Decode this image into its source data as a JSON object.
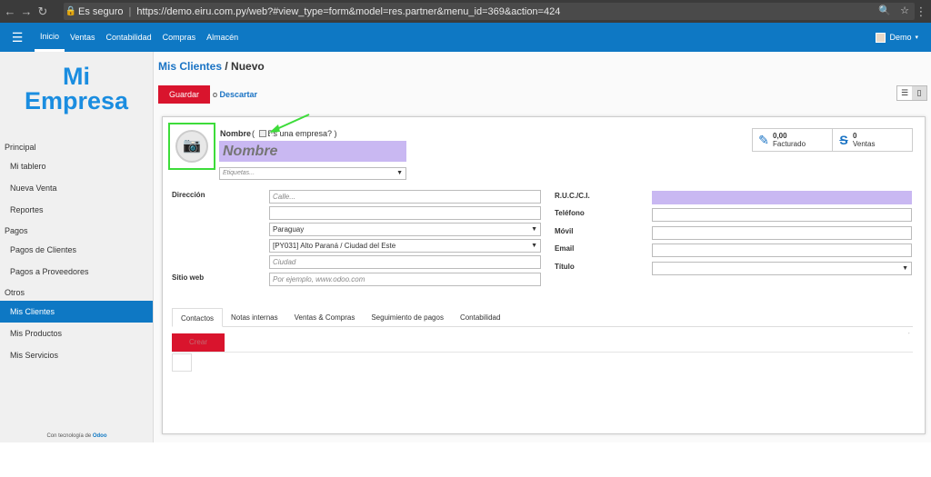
{
  "browser": {
    "secure_label": "Es seguro",
    "url": "https://demo.eiru.com.py/web?#view_type=form&model=res.partner&menu_id=369&action=424"
  },
  "appbar": {
    "items": [
      "Inicio",
      "Ventas",
      "Contabilidad",
      "Compras",
      "Almacén"
    ],
    "active_index": 0,
    "user": "Demo",
    "color": "#0e78c4"
  },
  "sidebar": {
    "logo_line1": "Mi",
    "logo_line2": "Empresa",
    "sections": [
      {
        "title": "Principal",
        "items": [
          "Mi tablero",
          "Nueva Venta",
          "Reportes"
        ]
      },
      {
        "title": "Pagos",
        "items": [
          "Pagos de Clientes",
          "Pagos a Proveedores"
        ]
      },
      {
        "title": "Otros",
        "items": [
          "Mis Clientes",
          "Mis Productos",
          "Mis Servicios"
        ]
      }
    ],
    "active_item": "Mis Clientes",
    "powered_prefix": "Con tecnología de",
    "powered_brand": "Odoo"
  },
  "main": {
    "breadcrumb_parent": "Mis Clientes",
    "breadcrumb_sep": " / ",
    "breadcrumb_current": "Nuevo",
    "save_label": "Guardar",
    "or_label": "o",
    "discard_label": "Descartar"
  },
  "form": {
    "name_label": "Nombre",
    "company_label": "Es una empresa?",
    "name_placeholder": "Nombre",
    "tags_placeholder": "Etiquetas...",
    "stats": [
      {
        "value": "0,00",
        "label": "Facturado",
        "icon": "edit-icon"
      },
      {
        "value": "0",
        "label": "Ventas",
        "icon": "strikethrough-s-icon"
      }
    ],
    "left": {
      "address_label": "Dirección",
      "website_label": "Sitio web",
      "street_placeholder": "Calle...",
      "street2_value": "",
      "country_value": "Paraguay",
      "state_value": "[PY031] Alto Paraná / Ciudad del Este",
      "city_placeholder": "Ciudad",
      "website_placeholder": "Por ejemplo, www.odoo.com"
    },
    "right": {
      "ruc_label": "R.U.C./C.I.",
      "phone_label": "Teléfono",
      "mobile_label": "Móvil",
      "email_label": "Email",
      "title_label": "Título"
    },
    "tabs": [
      "Contactos",
      "Notas internas",
      "Ventas & Compras",
      "Seguimiento de pagos",
      "Contabilidad"
    ],
    "active_tab": 0,
    "create_label": "Crear"
  }
}
